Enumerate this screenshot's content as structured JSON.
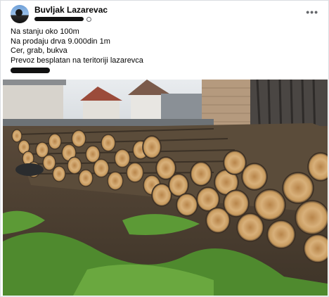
{
  "post": {
    "author": "Buvljak Lazarevac",
    "more_label": "•••",
    "lines": [
      "Na stanju oko 100m",
      "Na prodaju drva 9.000din 1m",
      "Cer, grab, bukva",
      "Prevoz besplatan na teritoriji lazarevca"
    ]
  },
  "icons": {
    "avatar": "avatar",
    "privacy": "globe-icon",
    "menu": "more-options-icon"
  },
  "colors": {
    "wood_light": "#d8b07a",
    "bark": "#5b4c3a",
    "grass": "#4f8a2e"
  }
}
